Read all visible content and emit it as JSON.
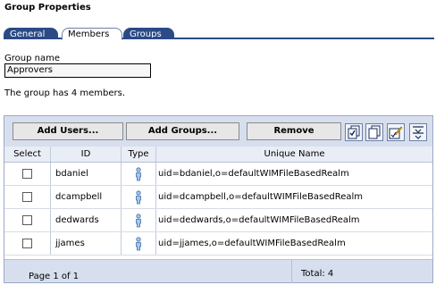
{
  "page": {
    "title": "Group Properties"
  },
  "tabs": [
    {
      "label": "General",
      "active": false
    },
    {
      "label": "Members",
      "active": true
    },
    {
      "label": "Groups",
      "active": false
    }
  ],
  "form": {
    "group_name_label": "Group name",
    "group_name_value": "Approvers"
  },
  "member_count_text": "The group has 4 members.",
  "toolbar": {
    "add_users": "Add Users...",
    "add_groups": "Add Groups...",
    "remove": "Remove",
    "icons": [
      "select-all-icon",
      "deselect-all-icon",
      "edit-sort-icon",
      "filter-icon"
    ]
  },
  "table": {
    "columns": [
      "Select",
      "ID",
      "Type",
      "Unique Name"
    ],
    "rows": [
      {
        "id": "bdaniel",
        "type": "user-icon",
        "unique_name": "uid=bdaniel,o=defaultWIMFileBasedRealm"
      },
      {
        "id": "dcampbell",
        "type": "user-icon",
        "unique_name": "uid=dcampbell,o=defaultWIMFileBasedRealm"
      },
      {
        "id": "dedwards",
        "type": "user-icon",
        "unique_name": "uid=dedwards,o=defaultWIMFileBasedRealm"
      },
      {
        "id": "jjames",
        "type": "user-icon",
        "unique_name": "uid=jjames,o=defaultWIMFileBasedRealm"
      }
    ],
    "footer": {
      "page_info": "Page 1 of 1",
      "total": "Total: 4"
    }
  }
}
